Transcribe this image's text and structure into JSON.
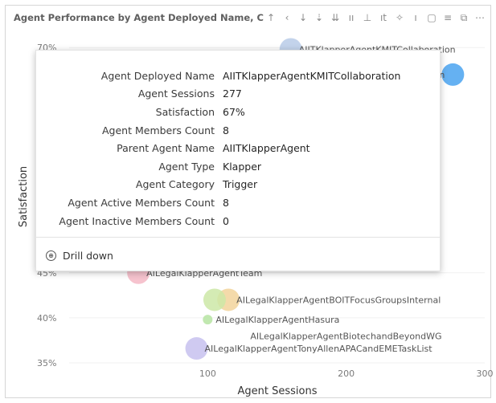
{
  "visual": {
    "title": "Agent Performance by Agent Deployed Name, C",
    "toolbar": [
      {
        "name": "drill-up-icon",
        "glyph": "↑"
      },
      {
        "name": "drill-mode-icon",
        "glyph": "‹"
      },
      {
        "name": "drill-down-icon",
        "glyph": "↓"
      },
      {
        "name": "go-to-next-level-icon",
        "glyph": "⇣"
      },
      {
        "name": "expand-level-icon",
        "glyph": "⇊"
      },
      {
        "name": "hierarchy-icon",
        "glyph": "ıı"
      },
      {
        "name": "hierarchy-icon",
        "glyph": "⊥"
      },
      {
        "name": "text-icon",
        "glyph": "ıt"
      },
      {
        "name": "pin-icon",
        "glyph": "✧"
      },
      {
        "name": "filter-icon",
        "glyph": "ı"
      },
      {
        "name": "copy-icon",
        "glyph": "▢"
      },
      {
        "name": "filter-icon",
        "glyph": "≡"
      },
      {
        "name": "focus-mode-icon",
        "glyph": "⧉"
      },
      {
        "name": "more-options-icon",
        "glyph": "⋯"
      }
    ]
  },
  "chart_data": {
    "type": "scatter",
    "title": "Agent Performance by Agent Deployed Name, C",
    "xlabel": "Agent Sessions",
    "ylabel": "Satisfaction",
    "xlim": [
      0,
      300
    ],
    "ylim": [
      35,
      71
    ],
    "x_ticks": [
      "100",
      "200",
      "300"
    ],
    "y_ticks": [
      "35%",
      "40%",
      "45%",
      "70%"
    ],
    "points": [
      {
        "label": "AIITKlapperAgentKMITCollaboration",
        "x": 277,
        "y": 67,
        "color": "#4aa3f0"
      },
      {
        "label": "AIITKlapperAgentKMITCollaboration",
        "x": 160,
        "y": 69.8,
        "color": "#b9cbe8"
      },
      {
        "label": "AILegalKlapperAgentTeam",
        "x": 50,
        "y": 45,
        "color": "#f4b9c5"
      },
      {
        "label": "AILegalKlapperAgentBOITFocusGroupsInternal",
        "x": 115,
        "y": 42,
        "color": "#f2d39b"
      },
      {
        "label": "",
        "x": 105,
        "y": 42,
        "color": "#cde8a7"
      },
      {
        "label": "AILegalKlapperAgentHasura",
        "x": 100,
        "y": 39.8,
        "color": "#b6e4a2"
      },
      {
        "label": "AILegalKlapperAgentBiotechandBeyondWG",
        "x": 125,
        "y": 38,
        "color": "#ffffff"
      },
      {
        "label": "AILegalKlapperAgentTonyAllenAPACandEMETaskList",
        "x": 92,
        "y": 36.6,
        "color": "#c7c1ef"
      }
    ]
  },
  "tooltip": {
    "rows": [
      {
        "key": "Agent Deployed Name",
        "value": "AIITKlapperAgentKMITCollaboration"
      },
      {
        "key": "Agent Sessions",
        "value": "277"
      },
      {
        "key": "Satisfaction",
        "value": "67%"
      },
      {
        "key": "Agent Members Count",
        "value": "8"
      },
      {
        "key": "Parent Agent Name",
        "value": "AIITKlapperAgent"
      },
      {
        "key": "Agent Type",
        "value": "Klapper"
      },
      {
        "key": "Agent Category",
        "value": "Trigger"
      },
      {
        "key": "Agent Active Members Count",
        "value": "8"
      },
      {
        "key": "Agent Inactive Members Count",
        "value": "0"
      }
    ],
    "drill_label": "Drill down",
    "drill_icon": "⊕"
  }
}
